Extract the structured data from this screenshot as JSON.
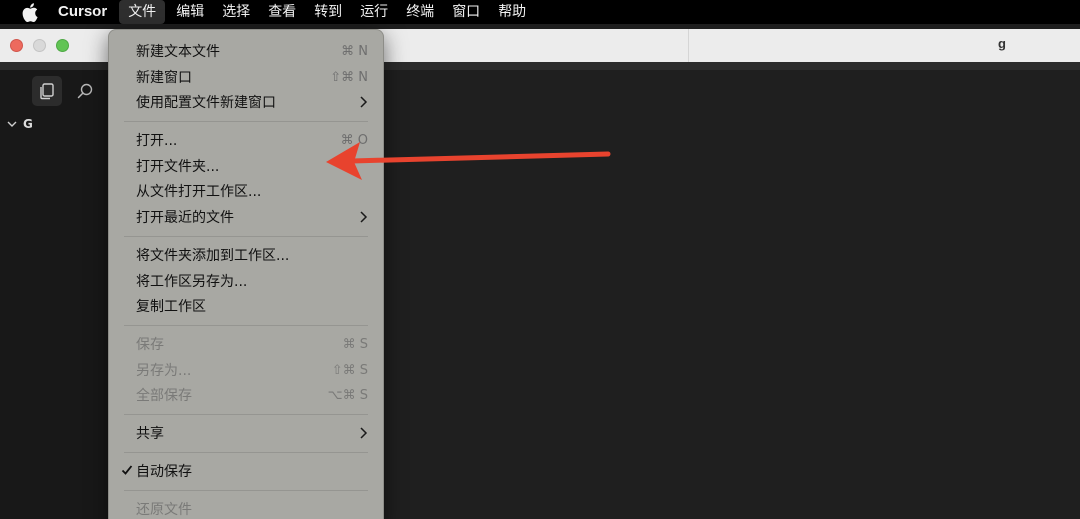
{
  "menubar": {
    "app_name": "Cursor",
    "items": [
      "文件",
      "编辑",
      "选择",
      "查看",
      "转到",
      "运行",
      "终端",
      "窗口",
      "帮助"
    ],
    "active_index": 0
  },
  "window": {
    "title": "g"
  },
  "sidebar": {
    "tree_root": "G"
  },
  "file_menu": {
    "groups": [
      [
        {
          "label": "新建文本文件",
          "shortcut": "⌘ N",
          "enabled": true
        },
        {
          "label": "新建窗口",
          "shortcut": "⇧⌘ N",
          "enabled": true
        },
        {
          "label": "使用配置文件新建窗口",
          "submenu": true,
          "enabled": true
        }
      ],
      [
        {
          "label": "打开...",
          "shortcut": "⌘ O",
          "enabled": true
        },
        {
          "label": "打开文件夹...",
          "enabled": true
        },
        {
          "label": "从文件打开工作区...",
          "enabled": true
        },
        {
          "label": "打开最近的文件",
          "submenu": true,
          "enabled": true
        }
      ],
      [
        {
          "label": "将文件夹添加到工作区...",
          "enabled": true
        },
        {
          "label": "将工作区另存为...",
          "enabled": true
        },
        {
          "label": "复制工作区",
          "enabled": true
        }
      ],
      [
        {
          "label": "保存",
          "shortcut": "⌘ S",
          "enabled": false
        },
        {
          "label": "另存为...",
          "shortcut": "⇧⌘ S",
          "enabled": false
        },
        {
          "label": "全部保存",
          "shortcut": "⌥⌘ S",
          "enabled": false
        }
      ],
      [
        {
          "label": "共享",
          "submenu": true,
          "enabled": true
        }
      ],
      [
        {
          "label": "自动保存",
          "checked": true,
          "enabled": true
        }
      ],
      [
        {
          "label": "还原文件",
          "enabled": false
        }
      ]
    ]
  },
  "annotation": {
    "arrow_color": "#e8432e",
    "points_to": "打开文件夹..."
  },
  "colors": {
    "menubar_bg": "#000000",
    "menu_bg": "#a8a8a3",
    "editor_bg": "#1f1f1f",
    "arrow": "#e8432e"
  }
}
